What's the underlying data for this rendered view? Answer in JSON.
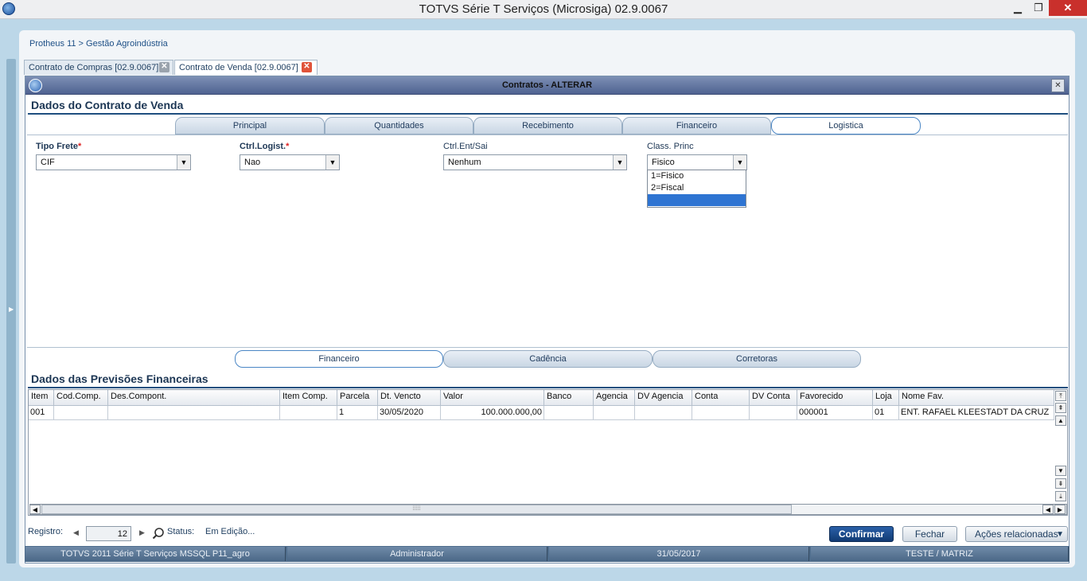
{
  "window": {
    "title": "TOTVS Série T Serviços (Microsiga) 02.9.0067",
    "min_icon": "minimize-icon",
    "max_icon": "maximize-icon",
    "close_icon": "close-icon",
    "min_glyph": "▁",
    "max_glyph": "❐",
    "close_glyph": "✕"
  },
  "breadcrumb": "Protheus 11 > Gestão Agroindústria",
  "tabs": [
    {
      "label": "Contrato de Compras [02.9.0067]",
      "close": "✕"
    },
    {
      "label": "Contrato de Venda [02.9.0067]",
      "close": "✕"
    }
  ],
  "dialog": {
    "title": "Contratos - ALTERAR",
    "close": "✕"
  },
  "contract": {
    "section_title": "Dados do Contrato de Venda",
    "folder_tabs": [
      "Principal",
      "Quantidades",
      "Recebimento",
      "Financeiro",
      "Logistica"
    ],
    "active_tab": "Logistica",
    "fields": {
      "tipo_frete": {
        "label": "Tipo Frete",
        "required": "*",
        "value": "CIF"
      },
      "ctrl_logist": {
        "label": "Ctrl.Logist.",
        "required": "*",
        "value": "Nao"
      },
      "ctrl_ent_sai": {
        "label": "Ctrl.Ent/Sai",
        "value": "Nenhum"
      },
      "class_princ": {
        "label": "Class. Princ",
        "value": "Fisico",
        "options": [
          "1=Fisico",
          "2=Fiscal",
          ""
        ]
      }
    }
  },
  "bottom_tabs": [
    "Financeiro",
    "Cadência",
    "Corretoras"
  ],
  "active_bottom_tab": "Financeiro",
  "previsoes": {
    "section_title": "Dados das Previsões Financeiras",
    "columns": [
      "Item",
      "Cod.Comp.",
      "Des.Compont.",
      "Item Comp.",
      "Parcela",
      "Dt. Vencto",
      "Valor",
      "Banco",
      "Agencia",
      "DV Agencia",
      "Conta",
      "DV Conta",
      "Favorecido",
      "Loja",
      "Nome Fav."
    ],
    "rows": [
      [
        "001",
        "",
        "",
        "",
        "1",
        "30/05/2020",
        "100.000.000,00",
        "",
        "",
        "",
        "",
        "",
        "000001",
        "01",
        "ENT. RAFAEL KLEESTADT DA CRUZ"
      ]
    ]
  },
  "footer": {
    "registro_label": "Registro:",
    "registro_value": "12",
    "status_label": "Status:",
    "status_value": "Em Edição...",
    "confirm": "Confirmar",
    "close": "Fechar",
    "actions": "Ações relacionadas"
  },
  "statusbar": [
    "TOTVS 2011 Série T Serviços MSSQL P11_agro",
    "Administrador",
    "31/05/2017",
    "TESTE / MATRIZ"
  ]
}
